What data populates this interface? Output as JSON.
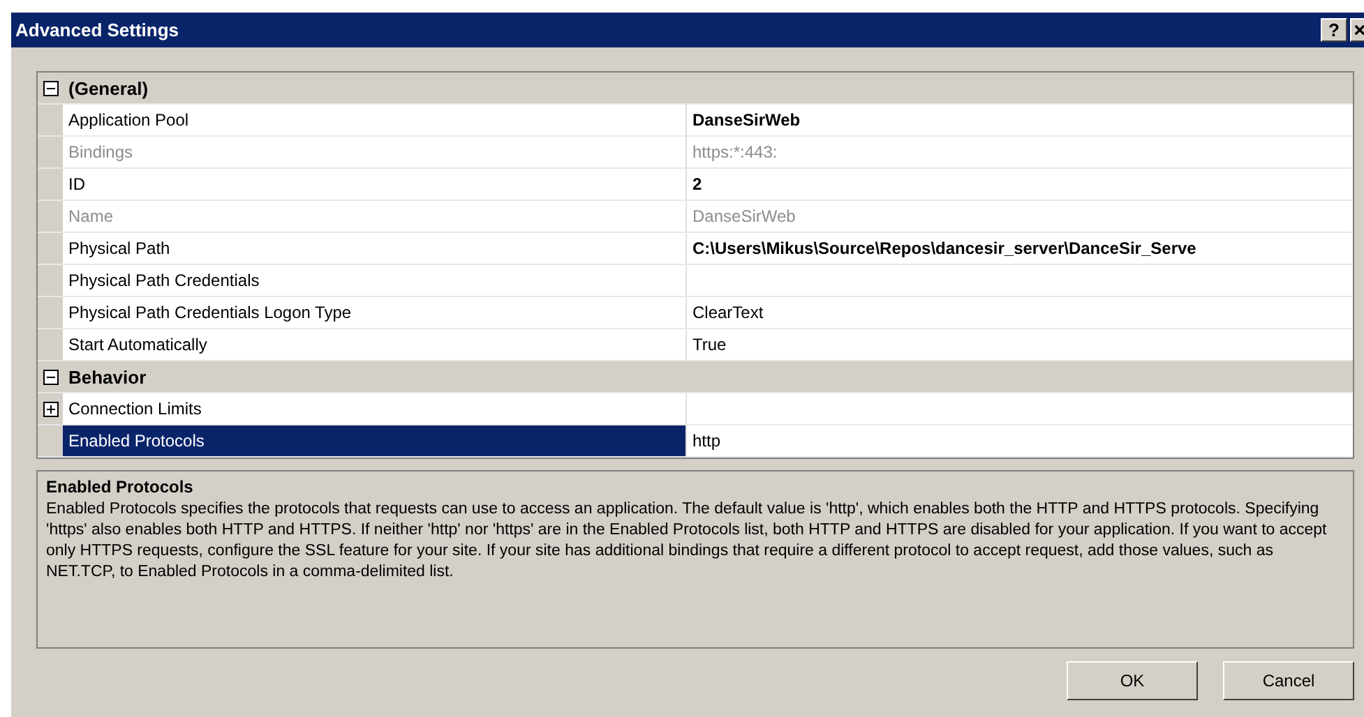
{
  "window": {
    "title": "Advanced Settings",
    "help_button": "?"
  },
  "categories": [
    {
      "name": "(General)",
      "expanded": true,
      "properties": [
        {
          "name": "Application Pool",
          "value": "DanseSirWeb",
          "disabled": false,
          "modified": true,
          "selected": false
        },
        {
          "name": "Bindings",
          "value": "https:*:443:",
          "disabled": true,
          "modified": false,
          "selected": false
        },
        {
          "name": "ID",
          "value": "2",
          "disabled": false,
          "modified": true,
          "selected": false
        },
        {
          "name": "Name",
          "value": "DanseSirWeb",
          "disabled": true,
          "modified": false,
          "selected": false
        },
        {
          "name": "Physical Path",
          "value": "C:\\Users\\Mikus\\Source\\Repos\\dancesir_server\\DanceSir_Serve",
          "disabled": false,
          "modified": true,
          "selected": false
        },
        {
          "name": "Physical Path Credentials",
          "disabled": false,
          "selected": false
        },
        {
          "name": "Physical Path Credentials Logon Type",
          "value": "ClearText",
          "disabled": false,
          "modified": false,
          "selected": false
        },
        {
          "name": "Start Automatically",
          "value": "True",
          "disabled": false,
          "modified": false,
          "selected": false
        }
      ]
    },
    {
      "name": "Behavior",
      "expanded": true,
      "properties": [
        {
          "name": "Connection Limits",
          "expanded": false,
          "disabled": false,
          "selected": false
        },
        {
          "name": "Enabled Protocols",
          "value": "http",
          "disabled": false,
          "modified": false,
          "selected": true
        }
      ]
    }
  ],
  "description": {
    "title": "Enabled Protocols",
    "text": "Enabled Protocols specifies the protocols that requests can use to access an application. The default value is 'http', which enables both the HTTP and HTTPS protocols. Specifying 'https' also enables both HTTP and HTTPS. If neither 'http' nor 'https' are in the Enabled Protocols list, both HTTP and HTTPS are disabled for your application. If you want to accept only HTTPS requests, configure the SSL feature for your site. If your site has additional bindings that require a different protocol to accept request, add those values, such as NET.TCP, to Enabled Protocols in a comma-delimited list."
  },
  "buttons": [
    "OK",
    "Cancel"
  ]
}
